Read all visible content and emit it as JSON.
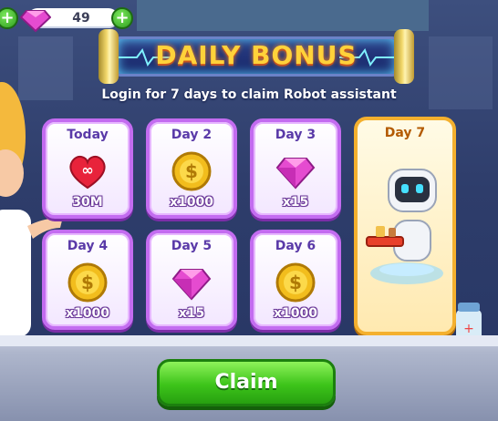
{
  "top_bar": {
    "gem_count": "49"
  },
  "header": {
    "title": "DAILY BONUS",
    "subtitle": "Login for 7 days to claim Robot assistant"
  },
  "rewards": [
    {
      "day": "Today",
      "amount": "30M",
      "icon": "heart-icon"
    },
    {
      "day": "Day 2",
      "amount": "x1000",
      "icon": "coin-icon"
    },
    {
      "day": "Day 3",
      "amount": "x15",
      "icon": "gem-icon"
    },
    {
      "day": "Day 4",
      "amount": "x1000",
      "icon": "coin-icon"
    },
    {
      "day": "Day 5",
      "amount": "x15",
      "icon": "gem-icon"
    },
    {
      "day": "Day 6",
      "amount": "x1000",
      "icon": "coin-icon"
    }
  ],
  "grand_reward": {
    "day": "Day 7",
    "icon": "robot-icon"
  },
  "claim_button": {
    "label": "Claim"
  },
  "colors": {
    "card_border": "#c36cf0",
    "grand_border": "#f4b02e",
    "claim": "#3dc41a",
    "title": "#ffd23a"
  }
}
